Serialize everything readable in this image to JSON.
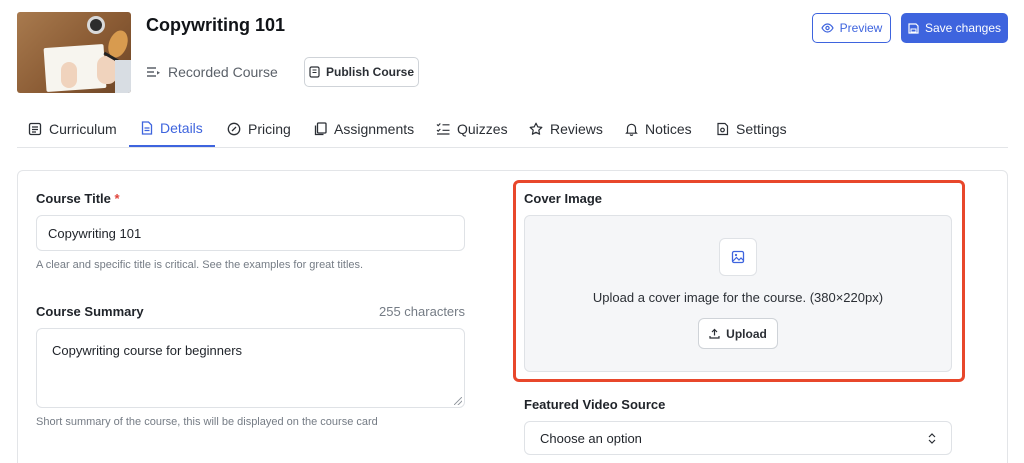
{
  "course": {
    "title": "Copywriting 101",
    "type": "Recorded Course",
    "publish_label": "Publish Course",
    "thumbnail_icon": "course-thumbnail-image"
  },
  "actions": {
    "preview_label": "Preview",
    "save_label": "Save changes"
  },
  "tabs": [
    {
      "label": "Curriculum",
      "icon": "curriculum-icon",
      "active": false
    },
    {
      "label": "Details",
      "icon": "document-icon",
      "active": true
    },
    {
      "label": "Pricing",
      "icon": "pricing-icon",
      "active": false
    },
    {
      "label": "Assignments",
      "icon": "assignments-icon",
      "active": false
    },
    {
      "label": "Quizzes",
      "icon": "quizzes-icon",
      "active": false
    },
    {
      "label": "Reviews",
      "icon": "star-icon",
      "active": false
    },
    {
      "label": "Notices",
      "icon": "bell-icon",
      "active": false
    },
    {
      "label": "Settings",
      "icon": "settings-icon",
      "active": false
    }
  ],
  "form": {
    "course_title": {
      "label": "Course Title",
      "required_mark": "*",
      "value": "Copywriting 101",
      "help": "A clear and specific title is critical. See the examples for great titles."
    },
    "course_summary": {
      "label": "Course Summary",
      "char_count": "255 characters",
      "value": "Copywriting course for beginners",
      "help": "Short summary of the course, this will be displayed on the course card"
    },
    "cover_image": {
      "label": "Cover Image",
      "prompt": "Upload a cover image for the course. (380×220px)",
      "upload_label": "Upload"
    },
    "featured_video": {
      "label": "Featured Video Source",
      "selected": "Choose an option"
    }
  },
  "colors": {
    "accent": "#3e64de",
    "highlight": "#e8472b",
    "required": "#e0433a"
  }
}
